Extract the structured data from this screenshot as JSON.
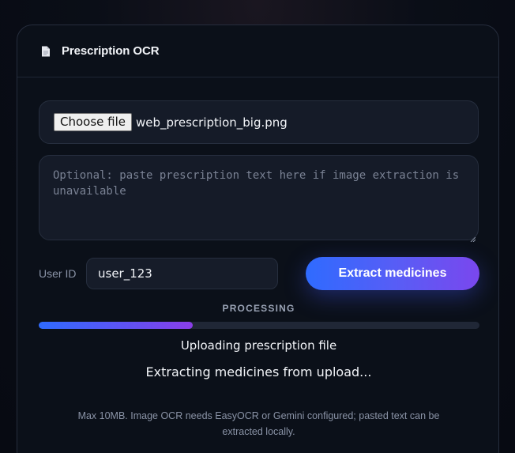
{
  "header": {
    "title": "Prescription OCR",
    "icon": "document-icon"
  },
  "upload": {
    "button_label": "Choose file",
    "file_name": "web_prescription_big.png"
  },
  "text_input": {
    "placeholder": "Optional: paste prescription text here if image extraction is unavailable",
    "value": ""
  },
  "user": {
    "label": "User ID",
    "value": "user_123"
  },
  "actions": {
    "extract_label": "Extract medicines"
  },
  "progress": {
    "label": "PROCESSING",
    "value": 0.35,
    "status_primary": "Uploading prescription file",
    "status_secondary": "Extracting medicines from upload..."
  },
  "footer": {
    "note": "Max 10MB. Image OCR needs EasyOCR or Gemini configured; pasted text can be extracted locally."
  },
  "colors": {
    "accent_start": "#2f6bff",
    "accent_end": "#7a47ee",
    "background": "#0b1019"
  }
}
